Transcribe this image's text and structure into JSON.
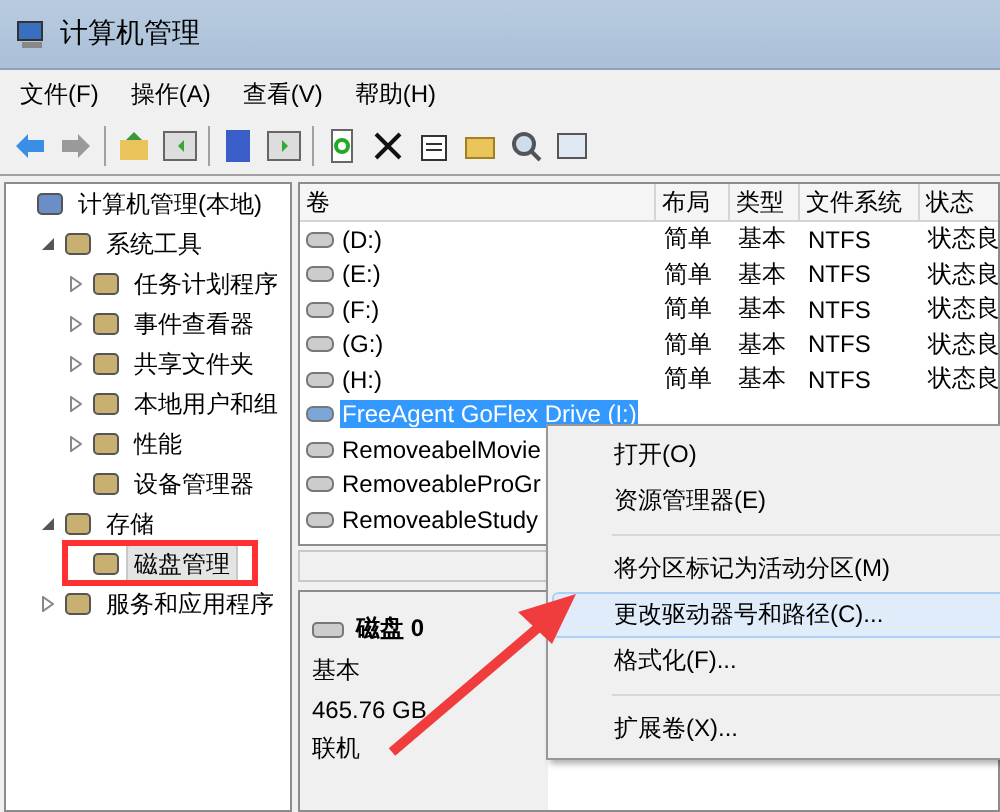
{
  "window": {
    "title": "计算机管理"
  },
  "menu_bar": [
    "文件(F)",
    "操作(A)",
    "查看(V)",
    "帮助(H)"
  ],
  "tree": [
    {
      "label": "计算机管理(本地)",
      "selected": false,
      "children": [
        {
          "label": "系统工具",
          "selected": false,
          "expanded": true,
          "children": [
            {
              "label": "任务计划程序",
              "selected": false,
              "expanded": false
            },
            {
              "label": "事件查看器",
              "selected": false,
              "expanded": false
            },
            {
              "label": "共享文件夹",
              "selected": false,
              "expanded": false
            },
            {
              "label": "本地用户和组",
              "selected": false,
              "expanded": false
            },
            {
              "label": "性能",
              "selected": false,
              "expanded": false
            },
            {
              "label": "设备管理器",
              "selected": false
            }
          ]
        },
        {
          "label": "存储",
          "selected": false,
          "expanded": true,
          "children": [
            {
              "label": "磁盘管理",
              "selected": true
            }
          ]
        },
        {
          "label": "服务和应用程序",
          "selected": false,
          "expanded": false
        }
      ]
    }
  ],
  "table": {
    "columns": [
      "卷",
      "布局",
      "类型",
      "文件系统",
      "状态"
    ],
    "rows": [
      {
        "cells": [
          "(D:)",
          "简单",
          "基本",
          "NTFS",
          "状态良"
        ],
        "selected": false
      },
      {
        "cells": [
          "(E:)",
          "简单",
          "基本",
          "NTFS",
          "状态良"
        ],
        "selected": false
      },
      {
        "cells": [
          "(F:)",
          "简单",
          "基本",
          "NTFS",
          "状态良"
        ],
        "selected": false
      },
      {
        "cells": [
          "(G:)",
          "简单",
          "基本",
          "NTFS",
          "状态良"
        ],
        "selected": false
      },
      {
        "cells": [
          "(H:)",
          "简单",
          "基本",
          "NTFS",
          "状态良"
        ],
        "selected": false
      },
      {
        "cells": [
          "FreeAgent GoFlex Drive (I:)"
        ],
        "selected": true
      },
      {
        "cells": [
          "RemoveabelMovie"
        ],
        "selected": false
      },
      {
        "cells": [
          "RemoveableProGr"
        ],
        "selected": false
      },
      {
        "cells": [
          "RemoveableStudy"
        ],
        "selected": false
      }
    ]
  },
  "disk": {
    "name": "磁盘 0",
    "type": "基本",
    "size": "465.76 GB",
    "status": "联机"
  },
  "context_menu": [
    {
      "kind": "item",
      "label": "打开(O)",
      "selected": false
    },
    {
      "kind": "item",
      "label": "资源管理器(E)",
      "selected": false
    },
    {
      "kind": "separator"
    },
    {
      "kind": "item",
      "label": "将分区标记为活动分区(M)",
      "selected": false
    },
    {
      "kind": "item",
      "label": "更改驱动器号和路径(C)...",
      "selected": true
    },
    {
      "kind": "item",
      "label": "格式化(F)...",
      "selected": false
    },
    {
      "kind": "separator"
    },
    {
      "kind": "item",
      "label": "扩展卷(X)...",
      "selected": false
    }
  ]
}
